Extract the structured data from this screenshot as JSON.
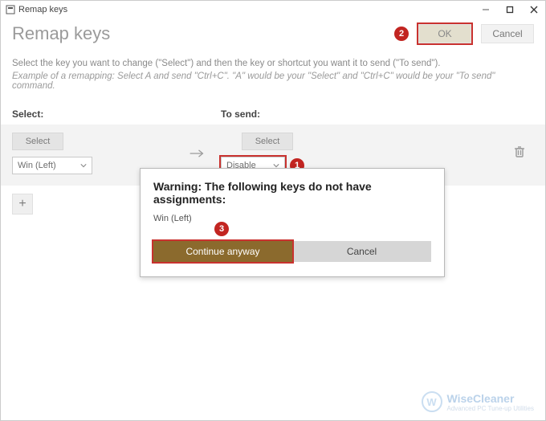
{
  "window": {
    "title": "Remap keys"
  },
  "header": {
    "page_title": "Remap keys",
    "ok_label": "OK",
    "cancel_label": "Cancel"
  },
  "instructions": {
    "line1": "Select the key you want to change (\"Select\") and then the key or shortcut you want it to send (\"To send\").",
    "line2": "Example of a remapping: Select A and send \"Ctrl+C\". \"A\" would be your \"Select\" and \"Ctrl+C\" would be your \"To send\" command."
  },
  "columns": {
    "select_label": "Select:",
    "tosend_label": "To send:"
  },
  "row": {
    "select_button": "Select",
    "select_dropdown_value": "Win (Left)",
    "tosend_select_button": "Select",
    "tosend_dropdown_value": "Disable"
  },
  "add_button_glyph": "+",
  "modal": {
    "title": "Warning: The following keys do not have assignments:",
    "body": "Win (Left)",
    "continue_label": "Continue anyway",
    "cancel_label": "Cancel"
  },
  "annotations": {
    "step1": "1",
    "step2": "2",
    "step3": "3"
  },
  "watermark": {
    "brand": "WiseCleaner",
    "tagline": "Advanced PC Tune-up Utilities",
    "glyph": "W"
  }
}
